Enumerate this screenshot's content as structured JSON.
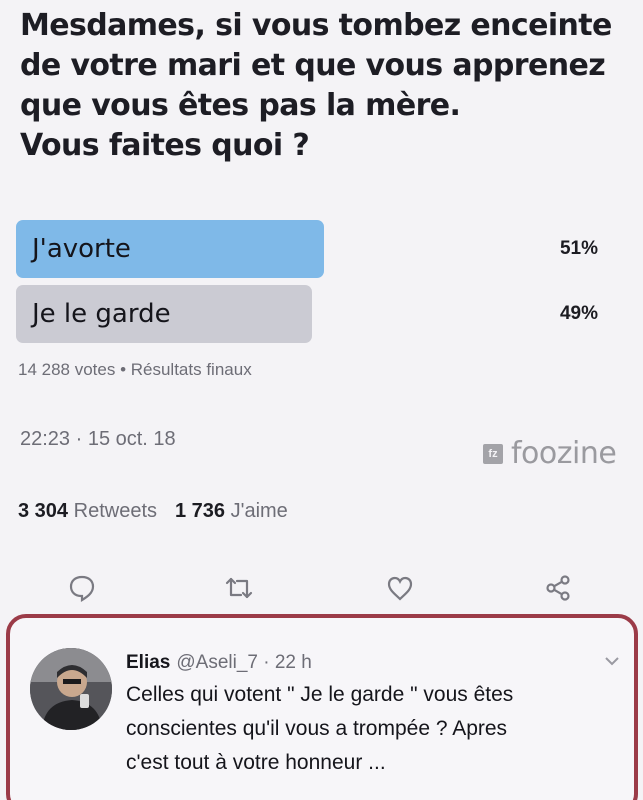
{
  "tweet": {
    "lines": [
      "Mesdames, si vous tombez enceinte",
      "de votre mari et que vous apprenez",
      "que vous êtes pas la mère.",
      "Vous faites quoi ?"
    ]
  },
  "poll": {
    "options": [
      {
        "label": "J'avorte",
        "percent_text": "51%",
        "percent": 51
      },
      {
        "label": "Je le garde",
        "percent_text": "49%",
        "percent": 49
      }
    ],
    "meta": "14 288 votes • Résultats finaux"
  },
  "timestamp": "22:23 · 15 oct. 18",
  "watermark": {
    "box": "fz",
    "text": "foozine"
  },
  "stats": {
    "retweets_count": "3 304",
    "retweets_label": "Retweets",
    "likes_count": "1 736",
    "likes_label": "J'aime"
  },
  "actions": [
    "reply-icon",
    "retweet-icon",
    "like-icon",
    "share-icon"
  ],
  "reply": {
    "name": "Elias",
    "handle_time": "@Aseli_7 · 22 h",
    "lines": [
      "Celles qui votent \" Je le garde \" vous êtes",
      "conscientes qu'il vous a trompée ? Apres",
      "c'est tout à votre honneur ..."
    ]
  },
  "colors": {
    "winner_bar": "#7fb9e8",
    "loser_bar": "#cbcbd3",
    "highlight_border": "#9b3b48"
  }
}
